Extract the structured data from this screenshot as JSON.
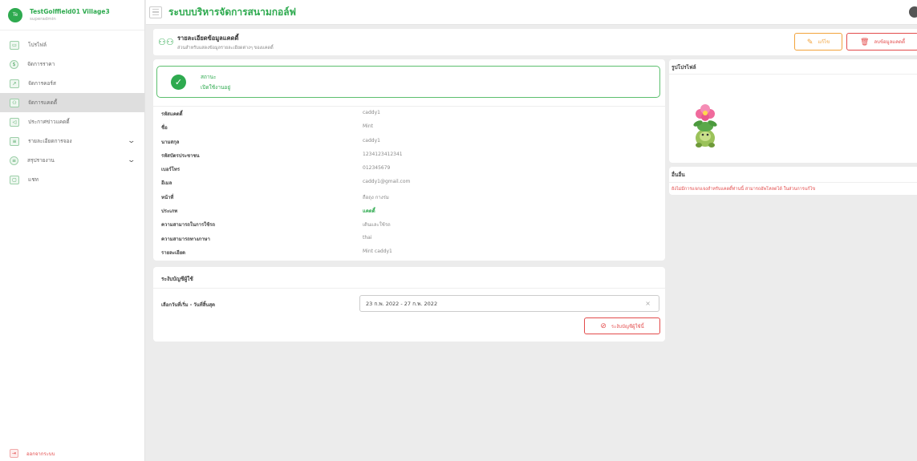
{
  "sidebar": {
    "avatar_text": "Te",
    "brand_name": "TestGolffield01 Village3",
    "brand_role": "superadmin",
    "items": [
      {
        "label": "โปรไฟล์",
        "icon": "id-card-icon"
      },
      {
        "label": "จัดการราคา",
        "icon": "price-icon"
      },
      {
        "label": "จัดการคอร์ส",
        "icon": "chart-icon"
      },
      {
        "label": "จัดการแคดดี้",
        "icon": "people-icon"
      },
      {
        "label": "ประกาศข่าวแคดดี้",
        "icon": "megaphone-icon"
      },
      {
        "label": "รายละเอียดการจอง",
        "icon": "list-icon"
      },
      {
        "label": "สรุปรายงาน",
        "icon": "database-icon"
      },
      {
        "label": "แชท",
        "icon": "chat-icon"
      }
    ],
    "logout_label": "ออกจากระบบ"
  },
  "topbar": {
    "title": "ระบบบริหารจัดการสนามกอล์ฟ"
  },
  "page_header": {
    "title": "รายละเอียดข้อมูลแคดดี้",
    "subtitle": "ส่วนสำหรับแสดงข้อมูลรายละเอียดต่างๆ ของแคดดี้",
    "edit_label": "แก้ไข",
    "delete_label": "ลบข้อมูลแคดดี้"
  },
  "status": {
    "label": "สถานะ",
    "value": "เปิดใช้งานอยู่"
  },
  "details": [
    {
      "key": "รหัสแคดดี้",
      "value": "caddy1"
    },
    {
      "key": "ชื่อ",
      "value": "Mint"
    },
    {
      "key": "นามสกุล",
      "value": "caddy1"
    },
    {
      "key": "รหัสบัตรประชาชน",
      "value": "1234123412341"
    },
    {
      "key": "เบอร์โทร",
      "value": "012345679"
    },
    {
      "key": "อีเมล",
      "value": "caddy1@gmail.com"
    },
    {
      "key": "หน้าที่",
      "value": "ถือถุง กางร่ม"
    },
    {
      "key": "ประเภท",
      "value": "แคดดี้"
    },
    {
      "key": "ความสามารถในการใช้รถ",
      "value": "เดินและใช้รถ"
    },
    {
      "key": "ความสามารถทางภาษา",
      "value": "thai"
    },
    {
      "key": "รายละเอียด",
      "value": "Mint caddy1"
    }
  ],
  "suspend": {
    "title": "ระงับบัญชีผู้ใช้",
    "date_label": "เลือกวันที่เริ่ม - วันที่สิ้นสุด",
    "date_value": "23 ก.พ. 2022 - 27 ก.พ. 2022",
    "button_label": "ระงับบัญชีผู้ใช้นี้"
  },
  "photo_card": {
    "title": "รูปโปรไฟล์"
  },
  "other_card": {
    "title": "อื่นอื่น",
    "note": "ยังไม่มีการแจกแจงสำหรับแคดดี้ท่านนี้ สามารถอัพโหลดได้ ในส่วนการแก้ไข"
  },
  "colors": {
    "brand_green": "#2eaa4f",
    "danger_red": "#e34b4b",
    "edit_orange": "#f2a33b"
  }
}
